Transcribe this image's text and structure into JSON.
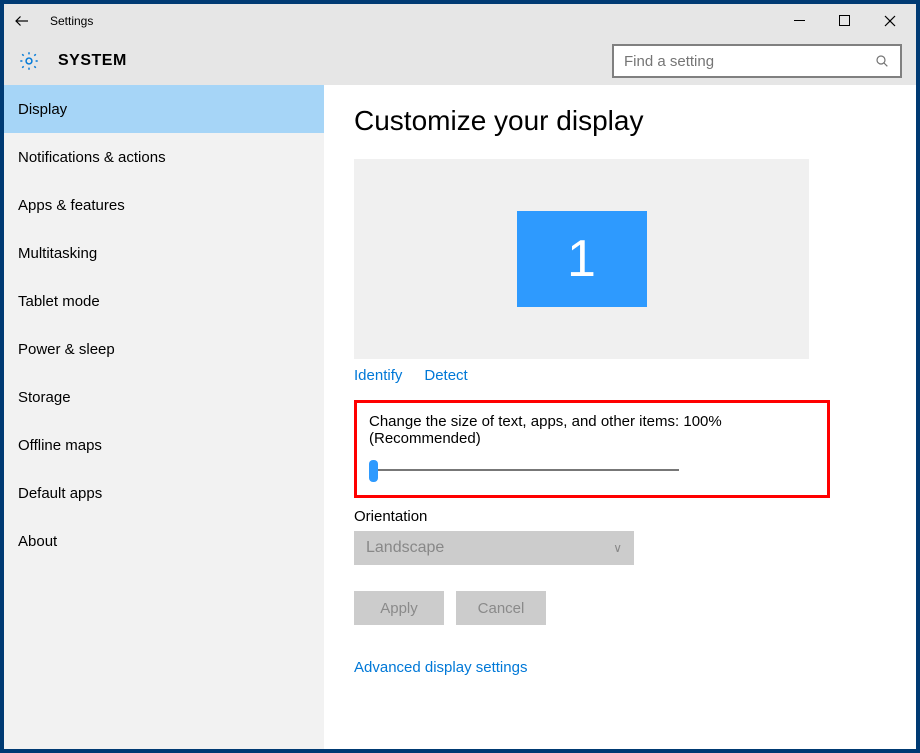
{
  "window": {
    "title": "Settings"
  },
  "header": {
    "title": "SYSTEM",
    "search_placeholder": "Find a setting"
  },
  "sidebar": {
    "items": [
      {
        "label": "Display",
        "active": true
      },
      {
        "label": "Notifications & actions"
      },
      {
        "label": "Apps & features"
      },
      {
        "label": "Multitasking"
      },
      {
        "label": "Tablet mode"
      },
      {
        "label": "Power & sleep"
      },
      {
        "label": "Storage"
      },
      {
        "label": "Offline maps"
      },
      {
        "label": "Default apps"
      },
      {
        "label": "About"
      }
    ]
  },
  "main": {
    "page_title": "Customize your display",
    "monitor_count": "1",
    "identify_label": "Identify",
    "detect_label": "Detect",
    "scale_label": "Change the size of text, apps, and other items: 100% (Recommended)",
    "scale_value_percent": 100,
    "orientation_label": "Orientation",
    "orientation_value": "Landscape",
    "apply_label": "Apply",
    "cancel_label": "Cancel",
    "advanced_link": "Advanced display settings"
  }
}
